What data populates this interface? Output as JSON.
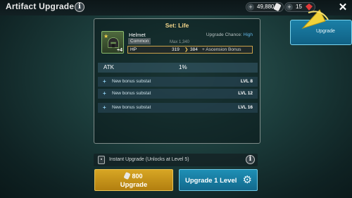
{
  "header": {
    "title": "Artifact Upgrade",
    "currencies": [
      {
        "icon": "silver-icon",
        "value": "49,880"
      },
      {
        "icon": "gem-icon",
        "value": "15"
      }
    ]
  },
  "artifact": {
    "set_title": "Set: Life",
    "name": "Helmet",
    "rarity": "Common",
    "level_badge": "+4",
    "upgrade_chance_label": "Upgrade Chance:",
    "upgrade_chance": "High",
    "max_value": "Max 1,340",
    "primary_stat": {
      "name": "HP",
      "from": "319",
      "to": "384",
      "bonus": "+ Ascension Bonus"
    }
  },
  "main_stat": {
    "name": "ATK",
    "value": "1%"
  },
  "substats": [
    {
      "label": "New bonus substat",
      "level": "LVL 8"
    },
    {
      "label": "New bonus substat",
      "level": "LVL 12"
    },
    {
      "label": "New bonus substat",
      "level": "LVL 16"
    }
  ],
  "instant_upgrade": {
    "label": "Instant Upgrade (Unlocks at Level 5)"
  },
  "buttons": {
    "upgrade_cost": "800",
    "upgrade_label": "Upgrade",
    "upgrade_level_label": "Upgrade 1 Level",
    "side_button_label": "Upgrade"
  },
  "colors": {
    "accent_gold": "#d7a624",
    "accent_blue": "#1e8fb5",
    "set_title": "#f2d58a"
  }
}
